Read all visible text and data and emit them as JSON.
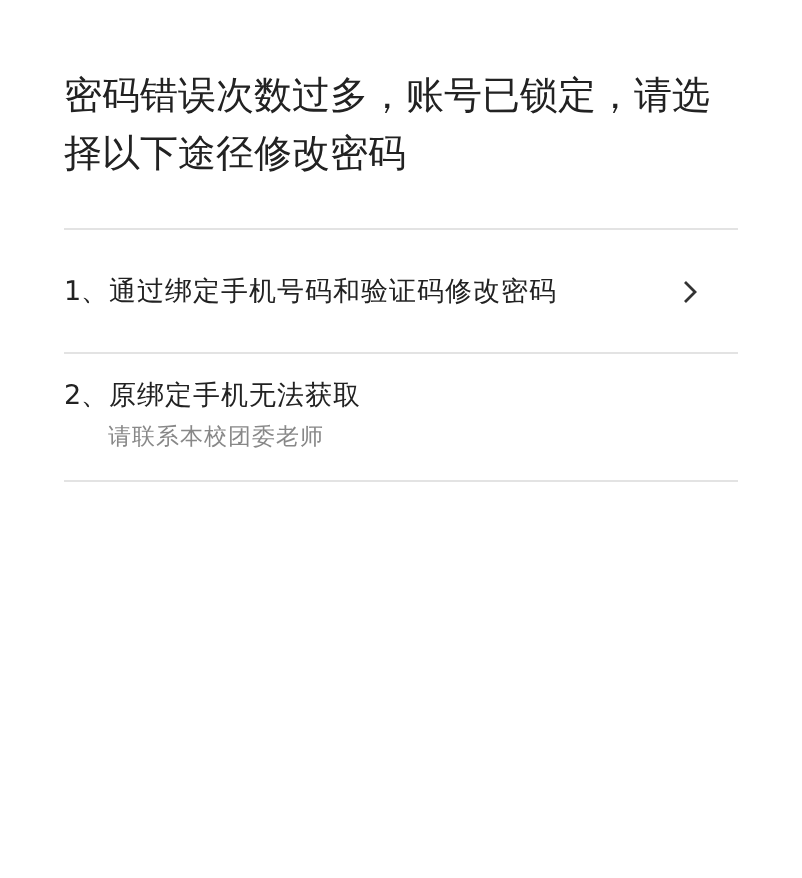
{
  "title": "密码错误次数过多，账号已锁定，请选择以下途径修改密码",
  "options": [
    {
      "kind": "link",
      "label": "1、通过绑定手机号码和验证码修改密码"
    },
    {
      "kind": "info",
      "label": "2、原绑定手机无法获取",
      "note": "请联系本校团委老师"
    }
  ]
}
